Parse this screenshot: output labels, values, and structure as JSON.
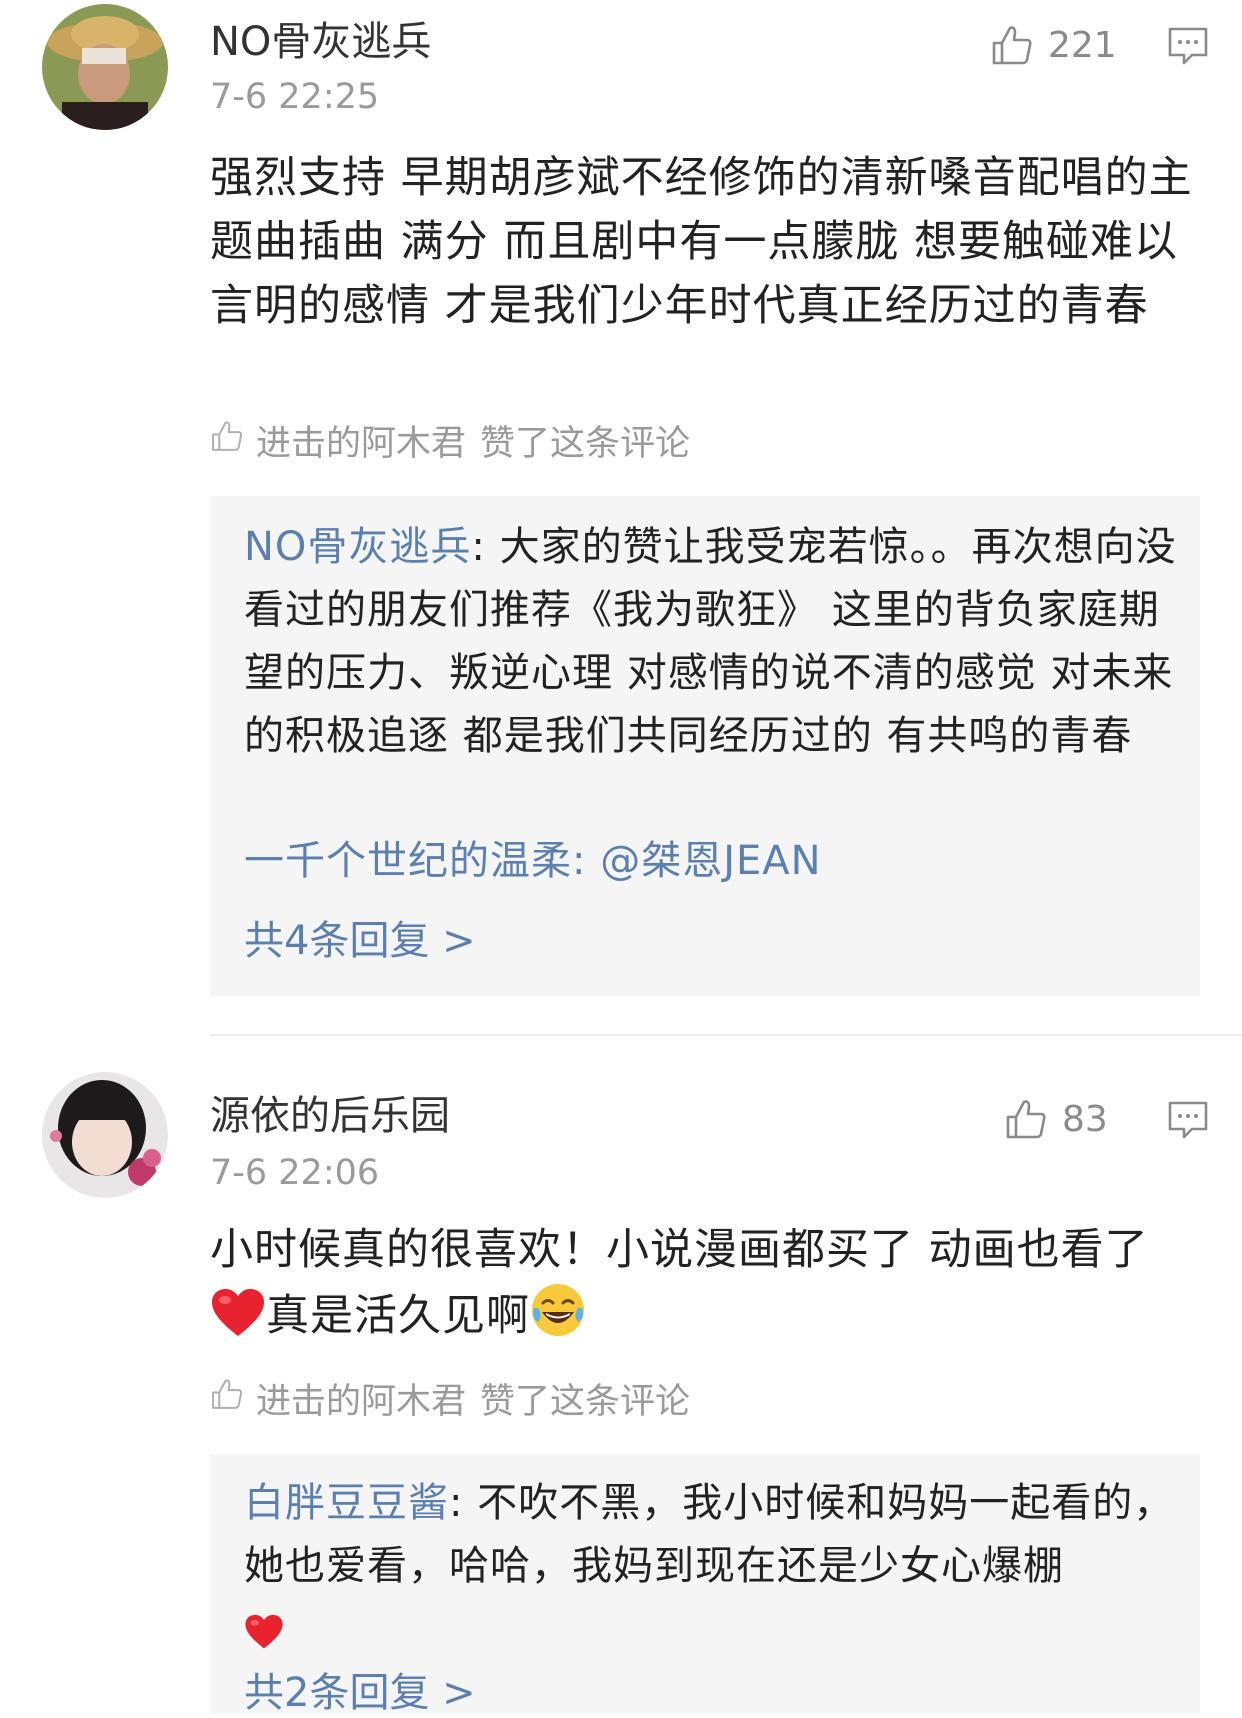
{
  "comments": [
    {
      "username": "NO骨灰逃兵",
      "timestamp": "7-6 22:25",
      "likes": "221",
      "text": "强烈支持 早期胡彦斌不经修饰的清新嗓音配唱的主题曲插曲 满分 而且剧中有一点朦胧 想要触碰难以言明的感情 才是我们少年时代真正经历过的青春",
      "liked_by_user": "进击的阿木君",
      "liked_by_suffix": "赞了这条评论",
      "replies": [
        {
          "author": "NO骨灰逃兵",
          "text": ": 大家的赞让我受宠若惊。。再次想向没看过的朋友们推荐《我为歌狂》 这里的背负家庭期望的压力、叛逆心理 对感情的说不清的感觉 对未来的积极追逐 都是我们共同经历过的 有共鸣的青春"
        },
        {
          "author": "一千个世纪的温柔",
          "text": ": @桀恩JEAN"
        }
      ],
      "reply_more": "共4条回复 >"
    },
    {
      "username": "源依的后乐园",
      "timestamp": "7-6 22:06",
      "likes": "83",
      "text_part1": "小时候真的很喜欢！小说漫画都买了 动画也看了",
      "text_part2": "真是活久见啊",
      "emojis": [
        "red-heart",
        "laughing-tears"
      ],
      "liked_by_user": "进击的阿木君",
      "liked_by_suffix": "赞了这条评论",
      "replies": [
        {
          "author": "白胖豆豆酱",
          "text": ": 不吹不黑，我小时候和妈妈一起看的，她也爱看，哈哈，我妈到现在还是少女心爆棚"
        }
      ],
      "reply_more": "共2条回复 >"
    }
  ],
  "colors": {
    "link_blue": "#5b7fae",
    "meta_gray": "#9a9a9a",
    "reply_bg": "#f5f5f6",
    "heart_red": "#e8232f"
  }
}
